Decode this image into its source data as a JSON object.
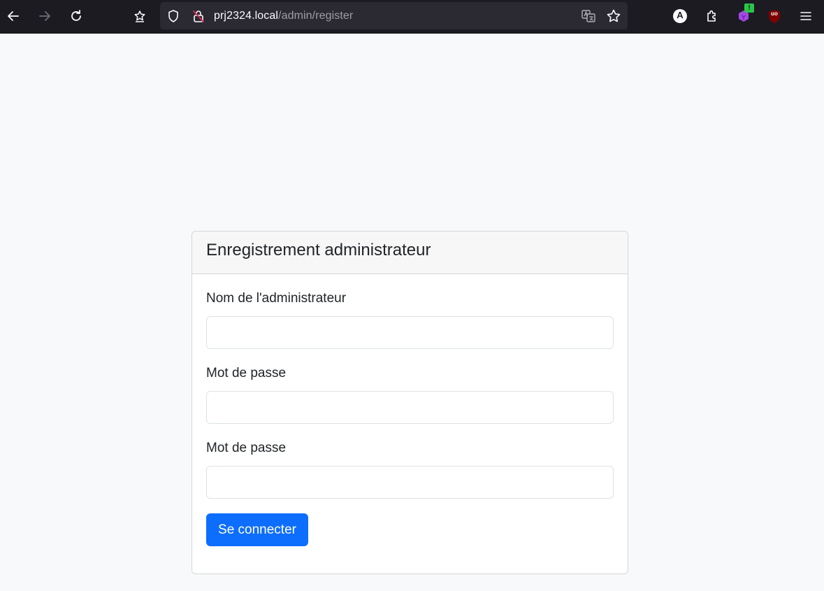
{
  "browser": {
    "url_host": "prj2324.local",
    "url_path": "/admin/register",
    "extension_badge": "!",
    "profile_letter": "A",
    "ublock_label": "uo"
  },
  "form": {
    "title": "Enregistrement administrateur",
    "fields": [
      {
        "label": "Nom de l'administrateur",
        "value": "",
        "type": "text"
      },
      {
        "label": "Mot de passe",
        "value": "",
        "type": "password"
      },
      {
        "label": "Mot de passe",
        "value": "",
        "type": "password"
      }
    ],
    "submit_label": "Se connecter"
  },
  "colors": {
    "primary": "#0d6efd",
    "page_bg": "#f8f9fa",
    "toolbar_bg": "#1c1b22"
  }
}
